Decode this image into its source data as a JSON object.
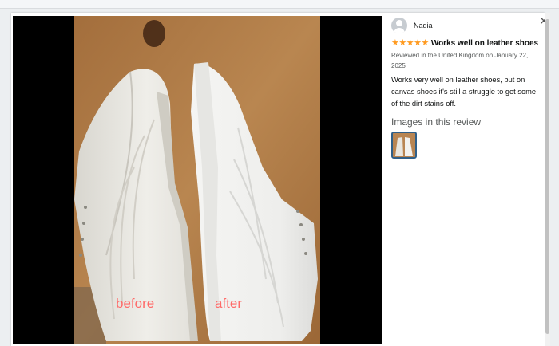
{
  "review": {
    "reviewer_name": "Nadia",
    "stars": "★★★★★",
    "title": "Works well on leather shoes",
    "meta": "Reviewed in the United Kingdom on January 22, 2025",
    "body": "Works very well on leather shoes, but on canvas shoes it's still a struggle to get some of the dirt stains off.",
    "images_heading": "Images in this review"
  },
  "photo": {
    "label_before": "before",
    "label_after": "after",
    "label_color": "#ff6a68"
  },
  "colors": {
    "star": "#ff9a1f",
    "thumb_border": "#2f5f89"
  },
  "icons": {
    "close": "close-icon",
    "avatar": "person-icon"
  }
}
